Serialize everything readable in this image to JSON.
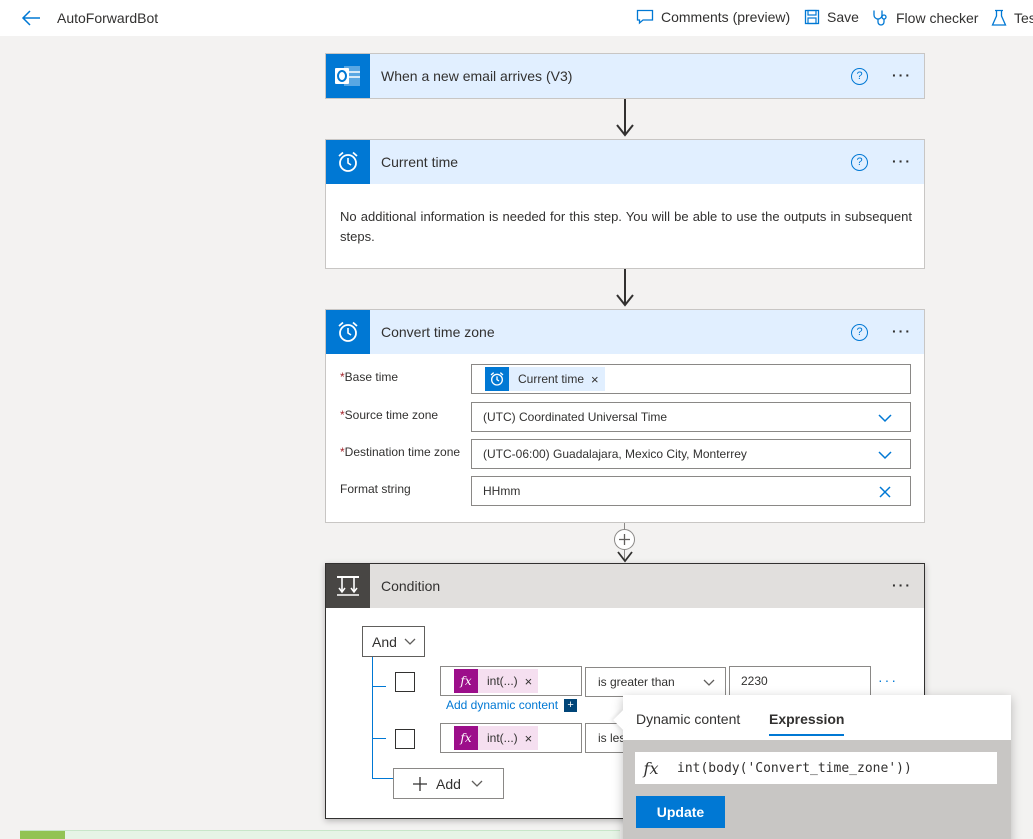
{
  "app": {
    "title": "AutoForwardBot"
  },
  "toolbar": {
    "comments_label": "Comments (preview)",
    "save_label": "Save",
    "flow_checker_label": "Flow checker",
    "test_label": "Tes"
  },
  "steps": {
    "trigger": {
      "title": "When a new email arrives (V3)",
      "icon": "outlook-icon"
    },
    "current_time": {
      "title": "Current time",
      "icon": "alarm-clock-icon",
      "description": "No additional information is needed for this step. You will be able to use the outputs in subsequent steps."
    },
    "convert": {
      "title": "Convert time zone",
      "icon": "alarm-clock-icon",
      "base_time_label": "Base time",
      "base_time_token": "Current time",
      "source_tz_label": "Source time zone",
      "source_tz_value": "(UTC) Coordinated Universal Time",
      "dest_tz_label": "Destination time zone",
      "dest_tz_value": "(UTC-06:00) Guadalajara, Mexico City, Monterrey",
      "format_label": "Format string",
      "format_value": "HHmm",
      "required_mark": "*"
    },
    "condition": {
      "title": "Condition",
      "icon": "condition-icon",
      "operator": "And",
      "rows": [
        {
          "token": "int(...)",
          "comparator": "is greater than",
          "value": "2230"
        },
        {
          "token": "int(...)",
          "comparator": "is les",
          "value": ""
        }
      ],
      "add_dynamic_label": "Add dynamic content",
      "add_label": "Add"
    }
  },
  "popup": {
    "tab_dynamic": "Dynamic content",
    "tab_expression": "Expression",
    "expression": "int(body('Convert_time_zone'))",
    "fx_symbol": "fx",
    "update_label": "Update"
  },
  "colors": {
    "accent": "#0078d4",
    "header_bg": "#e1efff",
    "expression_token": "#9c0e8a"
  }
}
